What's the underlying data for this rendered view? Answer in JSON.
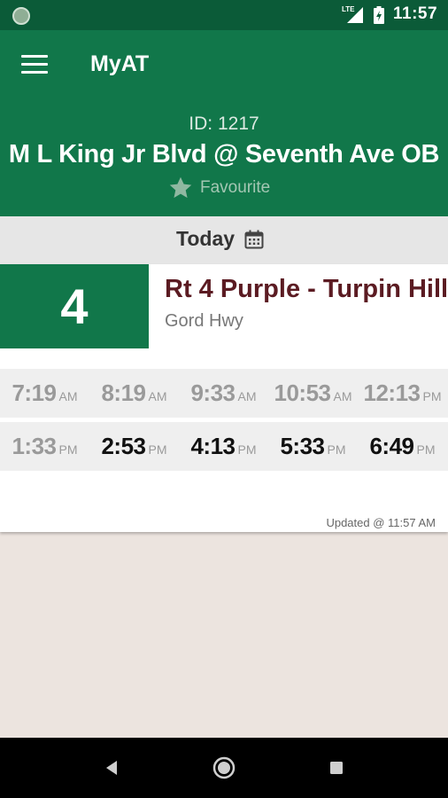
{
  "status_bar": {
    "network": "LTE",
    "time": "11:57"
  },
  "app_bar": {
    "title": "MyAT",
    "menu_icon": "hamburger-menu-icon"
  },
  "stop": {
    "id": "ID: 1217",
    "name": "M L King Jr Blvd @ Seventh Ave OB",
    "favourite_label": "Favourite",
    "favourite_icon": "star-icon"
  },
  "date_bar": {
    "label": "Today",
    "icon": "calendar-icon"
  },
  "route": {
    "number": "4",
    "name": "Rt 4 Purple - Turpin Hill",
    "subtitle": "Gord Hwy",
    "color": "#11774a",
    "name_color": "#5b1b22"
  },
  "times": [
    [
      {
        "time": "7:19",
        "period": "AM",
        "state": "past"
      },
      {
        "time": "8:19",
        "period": "AM",
        "state": "past"
      },
      {
        "time": "9:33",
        "period": "AM",
        "state": "past"
      },
      {
        "time": "10:53",
        "period": "AM",
        "state": "past"
      },
      {
        "time": "12:13",
        "period": "PM",
        "state": "past"
      }
    ],
    [
      {
        "time": "1:33",
        "period": "PM",
        "state": "past"
      },
      {
        "time": "2:53",
        "period": "PM",
        "state": "upcoming"
      },
      {
        "time": "4:13",
        "period": "PM",
        "state": "upcoming"
      },
      {
        "time": "5:33",
        "period": "PM",
        "state": "upcoming"
      },
      {
        "time": "6:49",
        "period": "PM",
        "state": "upcoming"
      }
    ]
  ],
  "updated": "Updated @ 11:57 AM",
  "nav_bar": {
    "back_icon": "back-triangle-icon",
    "home_icon": "home-circle-icon",
    "recents_icon": "recents-square-icon"
  },
  "colors": {
    "status_bar": "#0b5b38",
    "primary": "#11774a",
    "background": "#ece4df"
  }
}
